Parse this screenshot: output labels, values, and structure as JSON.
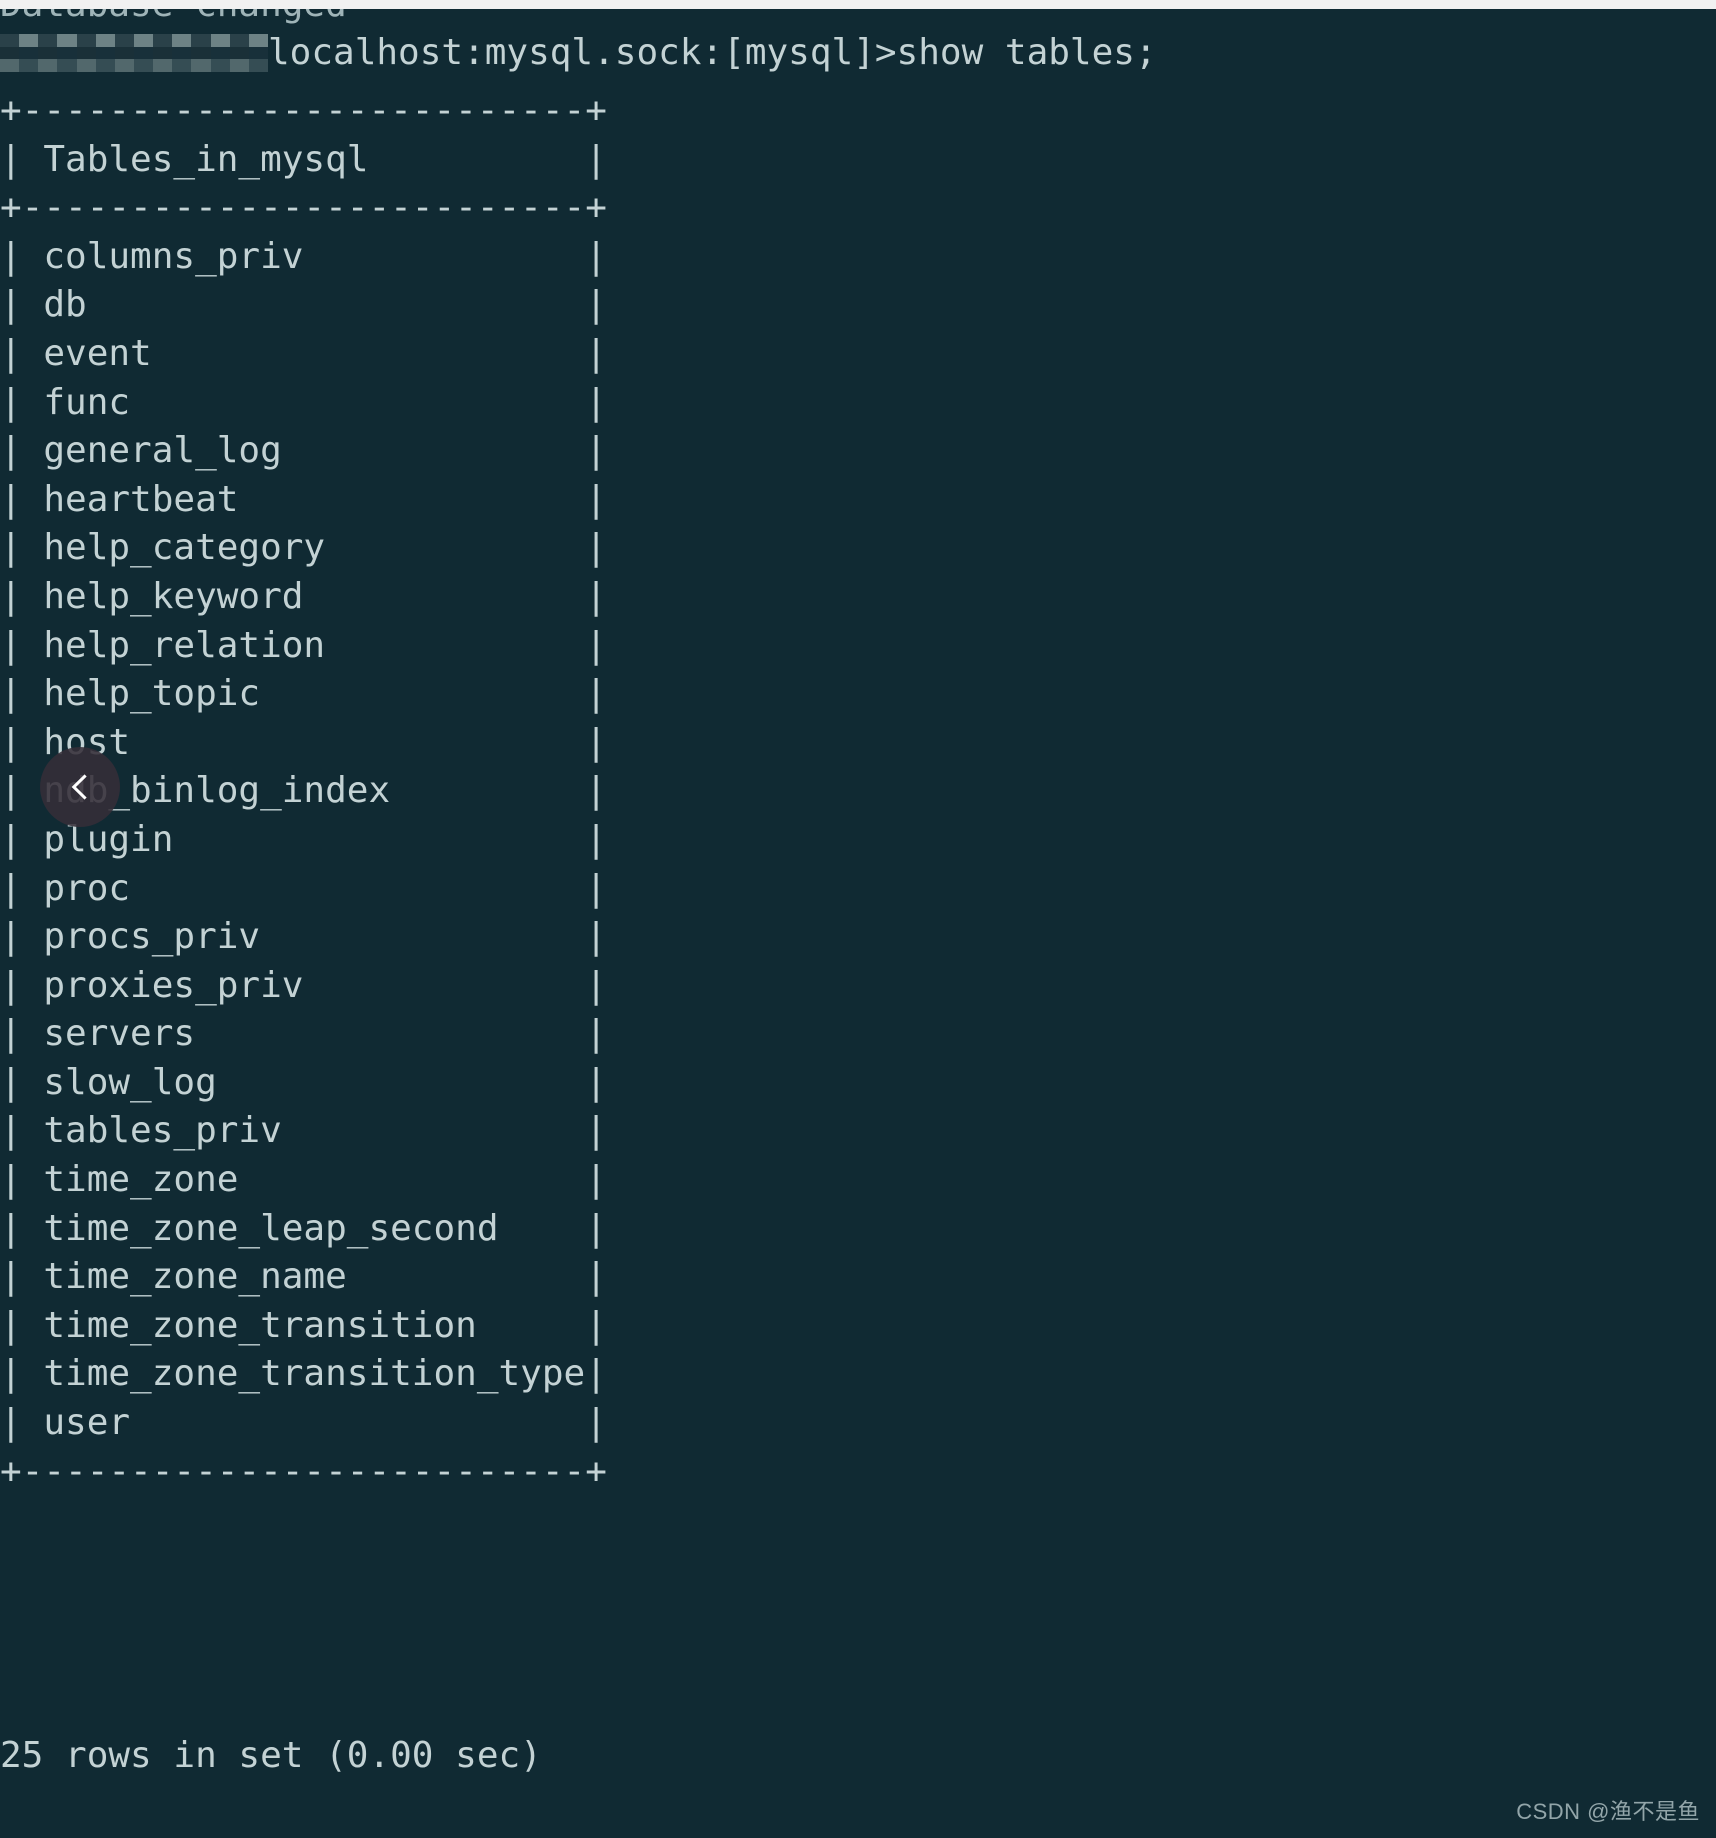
{
  "terminal": {
    "clipped_line": "Database changed",
    "prompt": {
      "redacted_label": "redacted-user-host",
      "visible_text": "localhost:mysql.sock:[mysql]>",
      "command": "show tables;",
      "full_line": "localhost:mysql.sock:[mysql]>show tables;"
    },
    "result_table": {
      "column_header": "Tables_in_mysql",
      "separator": "+--------------------------+",
      "column_inner_width": 26,
      "rows": [
        "columns_priv",
        "db",
        "event",
        "func",
        "general_log",
        "heartbeat",
        "help_category",
        "help_keyword",
        "help_relation",
        "help_topic",
        "host",
        "ndb_binlog_index",
        "plugin",
        "proc",
        "procs_priv",
        "proxies_priv",
        "servers",
        "slow_log",
        "tables_priv",
        "time_zone",
        "time_zone_leap_second",
        "time_zone_name",
        "time_zone_transition",
        "time_zone_transition_type",
        "user"
      ],
      "obscured_row_index": 11
    },
    "status": "25 rows in set (0.00 sec)"
  },
  "overlay": {
    "back_button_icon": "chevron-left-icon"
  },
  "watermark": "CSDN @渔不是鱼",
  "colors": {
    "background": "#102a33",
    "foreground": "#c3d2d4",
    "top_strip": "#f1f1f1",
    "overlay_button": "#342e38"
  }
}
